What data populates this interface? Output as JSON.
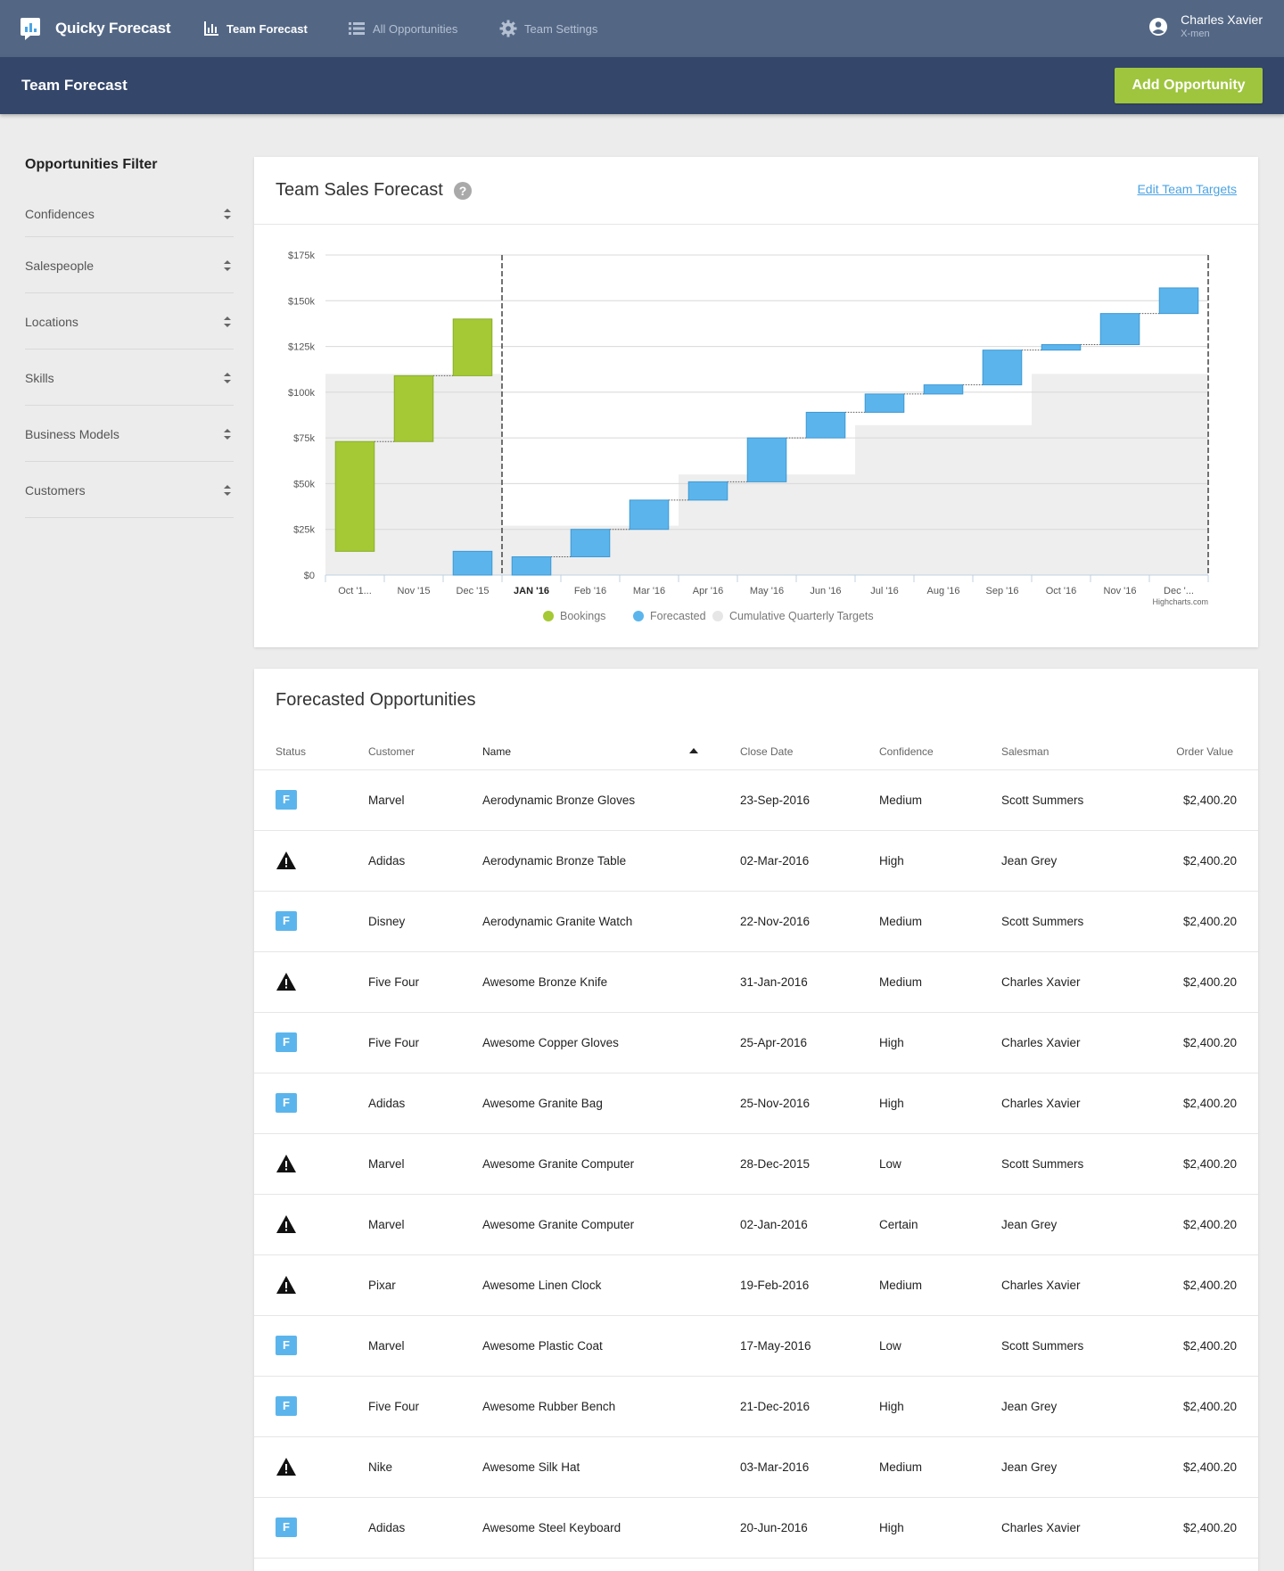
{
  "app": {
    "name": "Quicky Forecast",
    "nav": [
      {
        "label": "Team Forecast",
        "icon": "bar-chart-icon",
        "active": true
      },
      {
        "label": "All Opportunities",
        "icon": "list-icon",
        "active": false
      },
      {
        "label": "Team Settings",
        "icon": "gear-icon",
        "active": false
      }
    ],
    "user": {
      "name": "Charles Xavier",
      "team": "X-men"
    }
  },
  "subbar": {
    "title": "Team Forecast",
    "add_button": "Add Opportunity"
  },
  "filter": {
    "title": "Opportunities Filter",
    "items": [
      "Confidences",
      "Salespeople",
      "Locations",
      "Skills",
      "Business Models",
      "Customers"
    ]
  },
  "forecast_card": {
    "title": "Team Sales Forecast",
    "edit_link": "Edit Team Targets"
  },
  "chart_data": {
    "type": "waterfall",
    "categories": [
      "Oct '1...",
      "Nov '15",
      "Dec '15",
      "JAN '16",
      "Feb '16",
      "Mar '16",
      "Apr '16",
      "May '16",
      "Jun '16",
      "Jul '16",
      "Aug '16",
      "Sep '16",
      "Oct '16",
      "Nov '16",
      "Dec '..."
    ],
    "current_category": "JAN '16",
    "y_ticks": [
      "$0",
      "$25k",
      "$50k",
      "$75k",
      "$100k",
      "$125k",
      "$150k",
      "$175k"
    ],
    "ylim": [
      0,
      175000
    ],
    "credit": "Highcharts.com",
    "legend": [
      "Bookings",
      "Forecasted",
      "Cumulative Quarterly Targets"
    ],
    "colors": {
      "bookings": "#a4c935",
      "forecasted": "#5bb5ec",
      "targets": "#eeeeee"
    },
    "series": [
      {
        "name": "Bookings",
        "bars": [
          {
            "category": "Oct '1...",
            "low": 13000,
            "high": 73000
          },
          {
            "category": "Nov '15",
            "low": 73000,
            "high": 109000
          },
          {
            "category": "Dec '15",
            "low": 109000,
            "high": 140000
          }
        ]
      },
      {
        "name": "Forecasted",
        "bars": [
          {
            "category": "Dec '15",
            "low": 0,
            "high": 13000
          },
          {
            "category": "JAN '16",
            "low": 0,
            "high": 10000
          },
          {
            "category": "Feb '16",
            "low": 10000,
            "high": 25000
          },
          {
            "category": "Mar '16",
            "low": 25000,
            "high": 41000
          },
          {
            "category": "Apr '16",
            "low": 41000,
            "high": 51000
          },
          {
            "category": "May '16",
            "low": 51000,
            "high": 75000
          },
          {
            "category": "Jun '16",
            "low": 75000,
            "high": 89000
          },
          {
            "category": "Jul '16",
            "low": 89000,
            "high": 99000
          },
          {
            "category": "Aug '16",
            "low": 99000,
            "high": 104000
          },
          {
            "category": "Sep '16",
            "low": 104000,
            "high": 123000
          },
          {
            "category": "Oct '16",
            "low": 123000,
            "high": 126000
          },
          {
            "category": "Nov '16",
            "low": 126000,
            "high": 143000
          },
          {
            "category": "Dec '...",
            "low": 143000,
            "high": 157000
          }
        ]
      },
      {
        "name": "Cumulative Quarterly Targets",
        "steps": [
          {
            "from": "Oct '1...",
            "to": "Dec '15",
            "value": 110000
          },
          {
            "from": "JAN '16",
            "to": "Mar '16",
            "value": 27000
          },
          {
            "from": "Apr '16",
            "to": "Jun '16",
            "value": 55000
          },
          {
            "from": "Jul '16",
            "to": "Sep '16",
            "value": 82000
          },
          {
            "from": "Oct '16",
            "to": "Dec '...",
            "value": 110000
          }
        ]
      }
    ]
  },
  "opportunities": {
    "title": "Forecasted Opportunities",
    "columns": [
      "Status",
      "Customer",
      "Name",
      "Close Date",
      "Confidence",
      "Salesman",
      "Order Value"
    ],
    "sorted_column": "Name",
    "rows": [
      {
        "status": "F",
        "customer": "Marvel",
        "name": "Aerodynamic Bronze Gloves",
        "close": "23-Sep-2016",
        "confidence": "Medium",
        "salesman": "Scott Summers",
        "value": "$2,400.20"
      },
      {
        "status": "warning",
        "customer": "Adidas",
        "name": "Aerodynamic Bronze Table",
        "close": "02-Mar-2016",
        "confidence": "High",
        "salesman": "Jean Grey",
        "value": "$2,400.20"
      },
      {
        "status": "F",
        "customer": "Disney",
        "name": "Aerodynamic Granite Watch",
        "close": "22-Nov-2016",
        "confidence": "Medium",
        "salesman": "Scott Summers",
        "value": "$2,400.20"
      },
      {
        "status": "warning",
        "customer": "Five Four",
        "name": "Awesome Bronze Knife",
        "close": "31-Jan-2016",
        "confidence": "Medium",
        "salesman": "Charles Xavier",
        "value": "$2,400.20"
      },
      {
        "status": "F",
        "customer": "Five Four",
        "name": "Awesome Copper Gloves",
        "close": "25-Apr-2016",
        "confidence": "High",
        "salesman": "Charles Xavier",
        "value": "$2,400.20"
      },
      {
        "status": "F",
        "customer": "Adidas",
        "name": "Awesome Granite Bag",
        "close": "25-Nov-2016",
        "confidence": "High",
        "salesman": "Charles Xavier",
        "value": "$2,400.20"
      },
      {
        "status": "warning",
        "customer": "Marvel",
        "name": "Awesome Granite Computer",
        "close": "28-Dec-2015",
        "confidence": "Low",
        "salesman": "Scott Summers",
        "value": "$2,400.20"
      },
      {
        "status": "warning",
        "customer": "Marvel",
        "name": "Awesome Granite Computer",
        "close": "02-Jan-2016",
        "confidence": "Certain",
        "salesman": "Jean Grey",
        "value": "$2,400.20"
      },
      {
        "status": "warning",
        "customer": "Pixar",
        "name": "Awesome Linen Clock",
        "close": "19-Feb-2016",
        "confidence": "Medium",
        "salesman": "Charles Xavier",
        "value": "$2,400.20"
      },
      {
        "status": "F",
        "customer": "Marvel",
        "name": "Awesome Plastic Coat",
        "close": "17-May-2016",
        "confidence": "Low",
        "salesman": "Scott Summers",
        "value": "$2,400.20"
      },
      {
        "status": "F",
        "customer": "Five Four",
        "name": "Awesome Rubber Bench",
        "close": "21-Dec-2016",
        "confidence": "High",
        "salesman": "Jean Grey",
        "value": "$2,400.20"
      },
      {
        "status": "warning",
        "customer": "Nike",
        "name": "Awesome Silk Hat",
        "close": "03-Mar-2016",
        "confidence": "Medium",
        "salesman": "Jean Grey",
        "value": "$2,400.20"
      },
      {
        "status": "F",
        "customer": "Adidas",
        "name": "Awesome Steel Keyboard",
        "close": "20-Jun-2016",
        "confidence": "High",
        "salesman": "Charles Xavier",
        "value": "$2,400.20"
      }
    ]
  }
}
